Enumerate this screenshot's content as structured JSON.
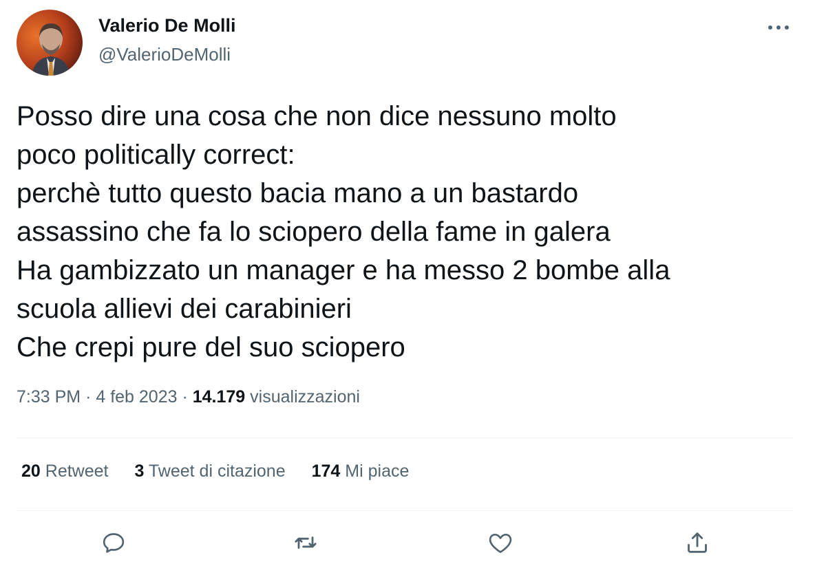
{
  "user": {
    "display_name": "Valerio De Molli",
    "handle": "@ValerioDeMolli"
  },
  "tweet": {
    "lines": [
      "Posso dire una cosa che non dice nessuno molto",
      "poco politically correct:",
      "perchè tutto questo bacia mano a un bastardo",
      "assassino che fa lo sciopero della fame in galera",
      "Ha gambizzato un manager e ha messo 2 bombe alla",
      "scuola allievi dei carabinieri",
      "Che crepi pure del suo sciopero"
    ]
  },
  "meta": {
    "time": "7:33 PM",
    "separator": "·",
    "date": "4 feb 2023",
    "views_count": "14.179",
    "views_label": "visualizzazioni"
  },
  "stats": {
    "retweets": {
      "count": "20",
      "label": "Retweet"
    },
    "quotes": {
      "count": "3",
      "label": "Tweet di citazione"
    },
    "likes": {
      "count": "174",
      "label": "Mi piace"
    }
  },
  "icons": {
    "more": "more-icon",
    "reply": "reply-icon",
    "retweet": "retweet-icon",
    "like": "like-icon",
    "share": "share-icon"
  },
  "colors": {
    "text": "#0f1419",
    "secondary": "#536471",
    "divider": "#eff3f4",
    "icon": "#536471"
  }
}
